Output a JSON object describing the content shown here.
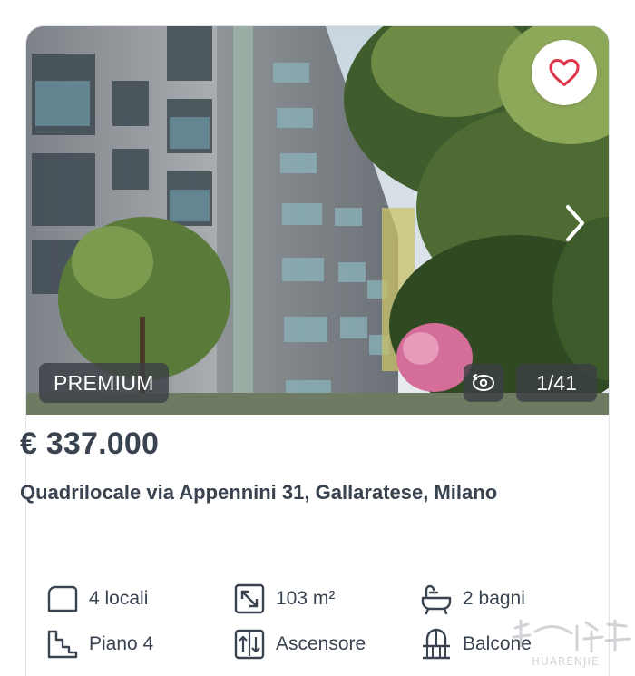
{
  "listing": {
    "badge": "PREMIUM",
    "photo_counter": "1/41",
    "price": "€ 337.000",
    "title": "Quadrilocale via Appennini 31, Gallaratese, Milano"
  },
  "features": [
    {
      "icon": "rooms-icon",
      "label": "4 locali"
    },
    {
      "icon": "area-icon",
      "label": "103 m²"
    },
    {
      "icon": "bathtub-icon",
      "label": "2 bagni"
    },
    {
      "icon": "stairs-icon",
      "label": "Piano 4"
    },
    {
      "icon": "elevator-icon",
      "label": "Ascensore"
    },
    {
      "icon": "balcony-icon",
      "label": "Balcone"
    }
  ],
  "watermark": {
    "text": "HUARENJIE"
  },
  "colors": {
    "favorite_heart": "#e0344a",
    "text": "#3a4350",
    "overlay": "#3c4046"
  }
}
